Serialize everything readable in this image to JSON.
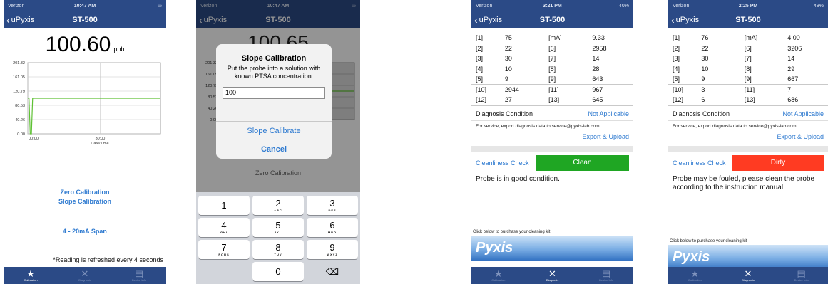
{
  "status": [
    {
      "carrier": "Verizon",
      "time": "10:47 AM",
      "battery": ""
    },
    {
      "carrier": "Verizon",
      "time": "10:47 AM",
      "battery": ""
    },
    {
      "carrier": "Verizon",
      "time": "3:21 PM",
      "battery": "40%"
    },
    {
      "carrier": "Verizon",
      "time": "2:25 PM",
      "battery": "48%"
    }
  ],
  "nav": {
    "back_label": "uPyxis",
    "title": "ST-500"
  },
  "tabs": {
    "calibration": "Calibration",
    "diagnosis": "Diagnosis",
    "device_info": "Device Info"
  },
  "colors": {
    "nav_bg": "#2b4a86",
    "link": "#2e7ad0",
    "clean": "#1fa623",
    "dirty": "#ff3b22"
  },
  "calibration": {
    "reading": "100.60",
    "unit": "ppb",
    "zero_label": "Zero Calibration",
    "slope_label": "Slope Calibration",
    "span_label": "4 - 20mA Span",
    "refresh_note": "*Reading is refreshed every 4 seconds"
  },
  "chart_data": {
    "type": "line",
    "xlabel": "Date/Time",
    "x_ticks": [
      "00:00",
      "30:00"
    ],
    "y_ticks": [
      0.0,
      40.26,
      80.53,
      120.79,
      161.05,
      201.32
    ],
    "y_tick_labels": [
      "0.00",
      "40.26",
      "80.53",
      "120.79",
      "161.05",
      "201.32"
    ],
    "ylim": [
      0,
      201.32
    ],
    "grid": true,
    "series": [
      {
        "color": "#5fc135",
        "x": [
          0,
          0.5,
          1,
          1.5,
          2,
          2.5,
          30,
          55
        ],
        "values": [
          100.6,
          100.6,
          0,
          0,
          100.6,
          100.6,
          100.6,
          100.6
        ]
      }
    ]
  },
  "dialog": {
    "background_reading": "100.65",
    "background_zero_label": "Zero Calibration",
    "title": "Slope Calibration",
    "message": "Put the probe into a solution with known PTSA concentration.",
    "input_value": "100",
    "calibrate_button": "Slope Calibrate",
    "cancel_button": "Cancel"
  },
  "keypad": [
    [
      {
        "n": "1",
        "l": ""
      },
      {
        "n": "2",
        "l": "ABC"
      },
      {
        "n": "3",
        "l": "DEF"
      }
    ],
    [
      {
        "n": "4",
        "l": "GHI"
      },
      {
        "n": "5",
        "l": "JKL"
      },
      {
        "n": "6",
        "l": "MNO"
      }
    ],
    [
      {
        "n": "7",
        "l": "PQRS"
      },
      {
        "n": "8",
        "l": "TUV"
      },
      {
        "n": "9",
        "l": "WXYZ"
      }
    ],
    [
      {
        "n": "",
        "l": ""
      },
      {
        "n": "0",
        "l": ""
      },
      {
        "n": "⌫",
        "l": ""
      }
    ]
  ],
  "diagnosis": [
    {
      "rows": [
        [
          "[1]",
          "75",
          "[mA]",
          "9.33"
        ],
        [
          "[2]",
          "22",
          "[6]",
          "2958"
        ],
        [
          "[3]",
          "30",
          "[7]",
          "14"
        ],
        [
          "[4]",
          "10",
          "[8]",
          "28"
        ],
        [
          "[5]",
          "9",
          "[9]",
          "643"
        ],
        [
          "[10]",
          "2944",
          "[11]",
          "967"
        ],
        [
          "[12]",
          "27",
          "[13]",
          "645"
        ]
      ],
      "condition_label": "Diagnosis Condition",
      "condition_value": "Not Applicable",
      "service_text": "For service, export diagnosis data to service@pyxis-lab.com",
      "export_label": "Export & Upload",
      "cleanliness_label": "Cleanliness Check",
      "cleanliness_status": "Clean",
      "status_color": "#1fa623",
      "condition_text": "Probe is in good condition.",
      "purchase_text": "Click below to purchase your cleaning kit",
      "banner_logo": "Pyxis"
    },
    {
      "rows": [
        [
          "[1]",
          "76",
          "[mA]",
          "4.00"
        ],
        [
          "[2]",
          "22",
          "[6]",
          "3206"
        ],
        [
          "[3]",
          "30",
          "[7]",
          "14"
        ],
        [
          "[4]",
          "10",
          "[8]",
          "29"
        ],
        [
          "[5]",
          "9",
          "[9]",
          "667"
        ],
        [
          "[10]",
          "3",
          "[11]",
          "7"
        ],
        [
          "[12]",
          "6",
          "[13]",
          "686"
        ]
      ],
      "condition_label": "Diagnosis Condition",
      "condition_value": "Not Applicable",
      "service_text": "For service, export diagnosis data to service@pyxis-lab.com",
      "export_label": "Export & Upload",
      "cleanliness_label": "Cleanliness Check",
      "cleanliness_status": "Dirty",
      "status_color": "#ff3b22",
      "condition_text": "Probe may be fouled, please clean the probe according to the instruction manual.",
      "purchase_text": "Click below to purchase your cleaning kit",
      "banner_logo": "Pyxis"
    }
  ]
}
